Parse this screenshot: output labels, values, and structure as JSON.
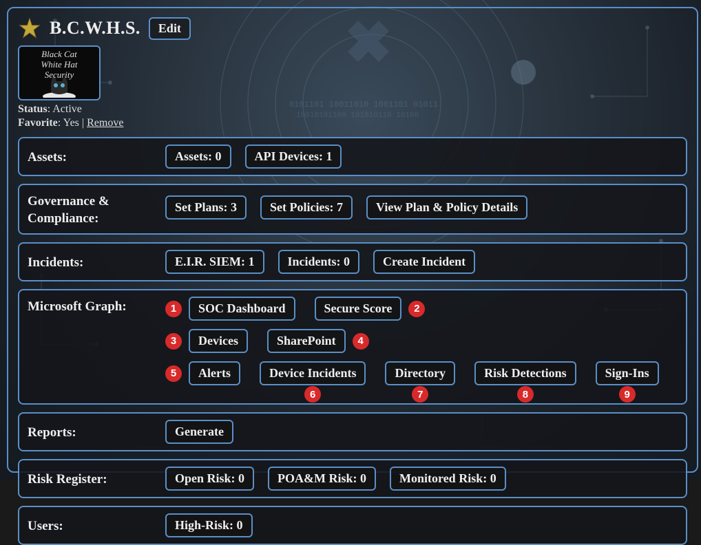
{
  "header": {
    "title": "B.C.W.H.S.",
    "edit_label": "Edit",
    "logo_lines": [
      "Black Cat",
      "White Hat",
      "Security"
    ],
    "status_label": "Status",
    "status_value": "Active",
    "favorite_label": "Favorite",
    "favorite_value": "Yes",
    "remove_label": "Remove"
  },
  "sections": {
    "assets": {
      "label": "Assets",
      "buttons": [
        {
          "id": "assets-count",
          "label": "Assets: 0"
        },
        {
          "id": "api-devices-count",
          "label": "API Devices: 1"
        }
      ]
    },
    "governance": {
      "label": "Governance & Compliance",
      "buttons": [
        {
          "id": "set-plans",
          "label": "Set Plans: 3"
        },
        {
          "id": "set-policies",
          "label": "Set Policies: 7"
        },
        {
          "id": "view-plan-policy",
          "label": "View Plan & Policy Details"
        }
      ]
    },
    "incidents": {
      "label": "Incidents",
      "buttons": [
        {
          "id": "eir-siem",
          "label": "E.I.R. SIEM: 1"
        },
        {
          "id": "incidents-count",
          "label": "Incidents: 0"
        },
        {
          "id": "create-incident",
          "label": "Create Incident"
        }
      ]
    },
    "msgraph": {
      "label": "Microsoft Graph",
      "row1": [
        {
          "badge": "1",
          "label": "SOC Dashboard"
        },
        {
          "label": "Secure Score",
          "badge_after": "2"
        }
      ],
      "row2": [
        {
          "badge": "3",
          "label": "Devices"
        },
        {
          "label": "SharePoint",
          "badge_after": "4"
        }
      ],
      "row3": [
        {
          "badge": "5",
          "label": "Alerts"
        },
        {
          "label": "Device Incidents",
          "badge_below": "6"
        },
        {
          "label": "Directory",
          "badge_below": "7"
        },
        {
          "label": "Risk Detections",
          "badge_below": "8"
        },
        {
          "label": "Sign-Ins",
          "badge_below": "9"
        }
      ]
    },
    "reports": {
      "label": "Reports",
      "buttons": [
        {
          "id": "generate",
          "label": "Generate"
        }
      ]
    },
    "risk": {
      "label": "Risk Register",
      "buttons": [
        {
          "id": "open-risk",
          "label": "Open Risk: 0"
        },
        {
          "id": "poam-risk",
          "label": "POA&M Risk: 0"
        },
        {
          "id": "monitored-risk",
          "label": "Monitored Risk: 0"
        }
      ]
    },
    "users": {
      "label": "Users",
      "buttons": [
        {
          "id": "high-risk",
          "label": "High-Risk: 0"
        }
      ]
    }
  },
  "colors": {
    "border": "#5a8fc7",
    "badge": "#d82a2a"
  }
}
